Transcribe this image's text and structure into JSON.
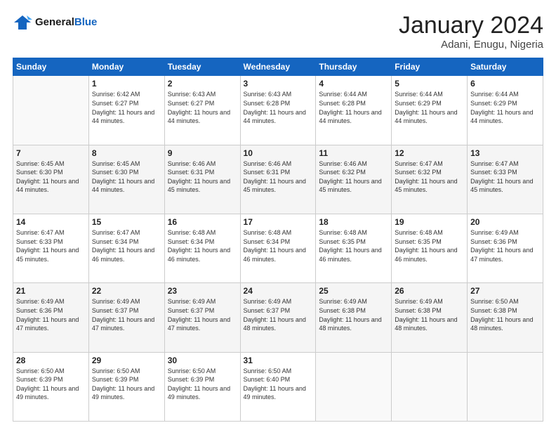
{
  "logo": {
    "line1": "General",
    "line2": "Blue"
  },
  "header": {
    "month": "January 2024",
    "location": "Adani, Enugu, Nigeria"
  },
  "weekdays": [
    "Sunday",
    "Monday",
    "Tuesday",
    "Wednesday",
    "Thursday",
    "Friday",
    "Saturday"
  ],
  "weeks": [
    [
      {
        "day": "",
        "sunrise": "",
        "sunset": "",
        "daylight": ""
      },
      {
        "day": "1",
        "sunrise": "Sunrise: 6:42 AM",
        "sunset": "Sunset: 6:27 PM",
        "daylight": "Daylight: 11 hours and 44 minutes."
      },
      {
        "day": "2",
        "sunrise": "Sunrise: 6:43 AM",
        "sunset": "Sunset: 6:27 PM",
        "daylight": "Daylight: 11 hours and 44 minutes."
      },
      {
        "day": "3",
        "sunrise": "Sunrise: 6:43 AM",
        "sunset": "Sunset: 6:28 PM",
        "daylight": "Daylight: 11 hours and 44 minutes."
      },
      {
        "day": "4",
        "sunrise": "Sunrise: 6:44 AM",
        "sunset": "Sunset: 6:28 PM",
        "daylight": "Daylight: 11 hours and 44 minutes."
      },
      {
        "day": "5",
        "sunrise": "Sunrise: 6:44 AM",
        "sunset": "Sunset: 6:29 PM",
        "daylight": "Daylight: 11 hours and 44 minutes."
      },
      {
        "day": "6",
        "sunrise": "Sunrise: 6:44 AM",
        "sunset": "Sunset: 6:29 PM",
        "daylight": "Daylight: 11 hours and 44 minutes."
      }
    ],
    [
      {
        "day": "7",
        "sunrise": "Sunrise: 6:45 AM",
        "sunset": "Sunset: 6:30 PM",
        "daylight": "Daylight: 11 hours and 44 minutes."
      },
      {
        "day": "8",
        "sunrise": "Sunrise: 6:45 AM",
        "sunset": "Sunset: 6:30 PM",
        "daylight": "Daylight: 11 hours and 44 minutes."
      },
      {
        "day": "9",
        "sunrise": "Sunrise: 6:46 AM",
        "sunset": "Sunset: 6:31 PM",
        "daylight": "Daylight: 11 hours and 45 minutes."
      },
      {
        "day": "10",
        "sunrise": "Sunrise: 6:46 AM",
        "sunset": "Sunset: 6:31 PM",
        "daylight": "Daylight: 11 hours and 45 minutes."
      },
      {
        "day": "11",
        "sunrise": "Sunrise: 6:46 AM",
        "sunset": "Sunset: 6:32 PM",
        "daylight": "Daylight: 11 hours and 45 minutes."
      },
      {
        "day": "12",
        "sunrise": "Sunrise: 6:47 AM",
        "sunset": "Sunset: 6:32 PM",
        "daylight": "Daylight: 11 hours and 45 minutes."
      },
      {
        "day": "13",
        "sunrise": "Sunrise: 6:47 AM",
        "sunset": "Sunset: 6:33 PM",
        "daylight": "Daylight: 11 hours and 45 minutes."
      }
    ],
    [
      {
        "day": "14",
        "sunrise": "Sunrise: 6:47 AM",
        "sunset": "Sunset: 6:33 PM",
        "daylight": "Daylight: 11 hours and 45 minutes."
      },
      {
        "day": "15",
        "sunrise": "Sunrise: 6:47 AM",
        "sunset": "Sunset: 6:34 PM",
        "daylight": "Daylight: 11 hours and 46 minutes."
      },
      {
        "day": "16",
        "sunrise": "Sunrise: 6:48 AM",
        "sunset": "Sunset: 6:34 PM",
        "daylight": "Daylight: 11 hours and 46 minutes."
      },
      {
        "day": "17",
        "sunrise": "Sunrise: 6:48 AM",
        "sunset": "Sunset: 6:34 PM",
        "daylight": "Daylight: 11 hours and 46 minutes."
      },
      {
        "day": "18",
        "sunrise": "Sunrise: 6:48 AM",
        "sunset": "Sunset: 6:35 PM",
        "daylight": "Daylight: 11 hours and 46 minutes."
      },
      {
        "day": "19",
        "sunrise": "Sunrise: 6:48 AM",
        "sunset": "Sunset: 6:35 PM",
        "daylight": "Daylight: 11 hours and 46 minutes."
      },
      {
        "day": "20",
        "sunrise": "Sunrise: 6:49 AM",
        "sunset": "Sunset: 6:36 PM",
        "daylight": "Daylight: 11 hours and 47 minutes."
      }
    ],
    [
      {
        "day": "21",
        "sunrise": "Sunrise: 6:49 AM",
        "sunset": "Sunset: 6:36 PM",
        "daylight": "Daylight: 11 hours and 47 minutes."
      },
      {
        "day": "22",
        "sunrise": "Sunrise: 6:49 AM",
        "sunset": "Sunset: 6:37 PM",
        "daylight": "Daylight: 11 hours and 47 minutes."
      },
      {
        "day": "23",
        "sunrise": "Sunrise: 6:49 AM",
        "sunset": "Sunset: 6:37 PM",
        "daylight": "Daylight: 11 hours and 47 minutes."
      },
      {
        "day": "24",
        "sunrise": "Sunrise: 6:49 AM",
        "sunset": "Sunset: 6:37 PM",
        "daylight": "Daylight: 11 hours and 48 minutes."
      },
      {
        "day": "25",
        "sunrise": "Sunrise: 6:49 AM",
        "sunset": "Sunset: 6:38 PM",
        "daylight": "Daylight: 11 hours and 48 minutes."
      },
      {
        "day": "26",
        "sunrise": "Sunrise: 6:49 AM",
        "sunset": "Sunset: 6:38 PM",
        "daylight": "Daylight: 11 hours and 48 minutes."
      },
      {
        "day": "27",
        "sunrise": "Sunrise: 6:50 AM",
        "sunset": "Sunset: 6:38 PM",
        "daylight": "Daylight: 11 hours and 48 minutes."
      }
    ],
    [
      {
        "day": "28",
        "sunrise": "Sunrise: 6:50 AM",
        "sunset": "Sunset: 6:39 PM",
        "daylight": "Daylight: 11 hours and 49 minutes."
      },
      {
        "day": "29",
        "sunrise": "Sunrise: 6:50 AM",
        "sunset": "Sunset: 6:39 PM",
        "daylight": "Daylight: 11 hours and 49 minutes."
      },
      {
        "day": "30",
        "sunrise": "Sunrise: 6:50 AM",
        "sunset": "Sunset: 6:39 PM",
        "daylight": "Daylight: 11 hours and 49 minutes."
      },
      {
        "day": "31",
        "sunrise": "Sunrise: 6:50 AM",
        "sunset": "Sunset: 6:40 PM",
        "daylight": "Daylight: 11 hours and 49 minutes."
      },
      {
        "day": "",
        "sunrise": "",
        "sunset": "",
        "daylight": ""
      },
      {
        "day": "",
        "sunrise": "",
        "sunset": "",
        "daylight": ""
      },
      {
        "day": "",
        "sunrise": "",
        "sunset": "",
        "daylight": ""
      }
    ]
  ]
}
